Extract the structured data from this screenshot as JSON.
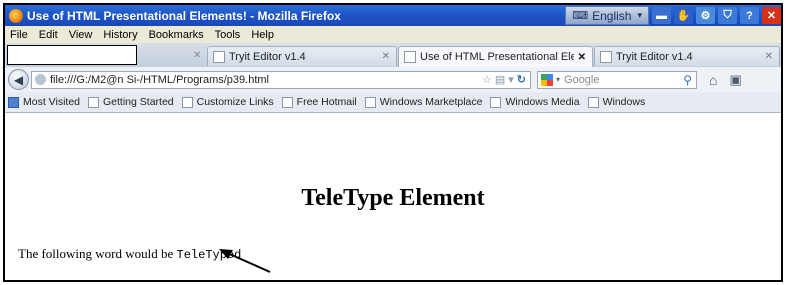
{
  "window": {
    "title": "Use of HTML Presentational Elements! - Mozilla Firefox",
    "language": "English"
  },
  "menu": [
    "File",
    "Edit",
    "View",
    "History",
    "Bookmarks",
    "Tools",
    "Help"
  ],
  "tabs": [
    {
      "label": "Tryit Editor v1.4"
    },
    {
      "label": "Use of HTML Presentational Elements!"
    },
    {
      "label": "Tryit Editor v1.4"
    }
  ],
  "nav": {
    "url": "file:///G:/M2@n Si-/HTML/Programs/p39.html",
    "search_placeholder": "Google"
  },
  "bookmarks": [
    "Most Visited",
    "Getting Started",
    "Customize Links",
    "Free Hotmail",
    "Windows Marketplace",
    "Windows Media",
    "Windows"
  ],
  "page": {
    "heading": "TeleType Element",
    "paragraph_text": "The following word would be",
    "teletype_word": "TeleTyped"
  }
}
